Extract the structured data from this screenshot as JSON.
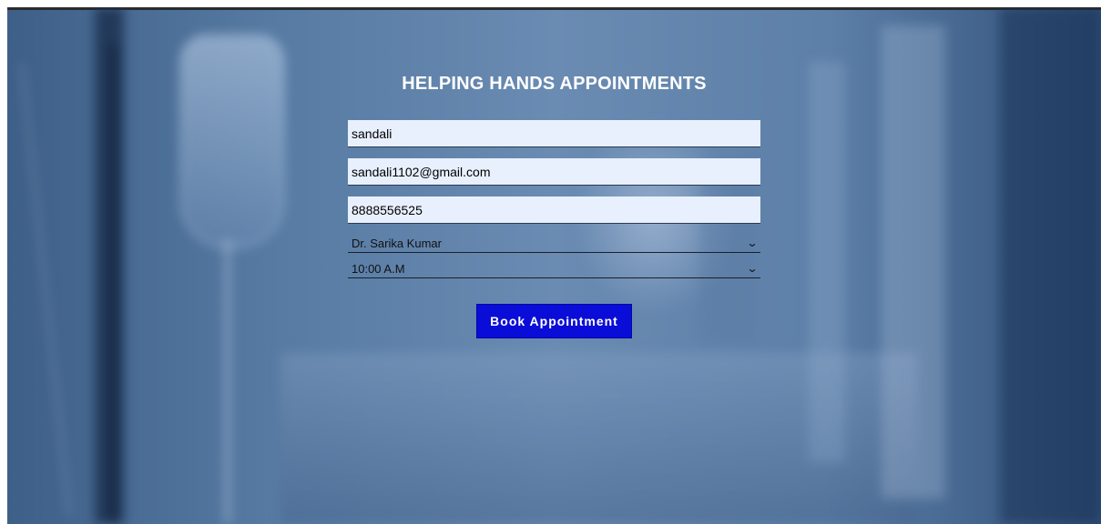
{
  "page": {
    "title": "HELPING HANDS APPOINTMENTS"
  },
  "form": {
    "name": {
      "value": "sandali"
    },
    "email": {
      "value": "sandali1102@gmail.com"
    },
    "phone": {
      "value": "8888556525"
    },
    "doctor": {
      "selected": "Dr. Sarika Kumar"
    },
    "time": {
      "selected": "10:00 A.M"
    },
    "submit_label": "Book Appointment"
  },
  "colors": {
    "button_bg": "#0a0cd8",
    "field_bg": "#e8f0fe",
    "title_text": "#ffffff"
  },
  "icons": {
    "dropdown": "chevron-down-icon"
  }
}
